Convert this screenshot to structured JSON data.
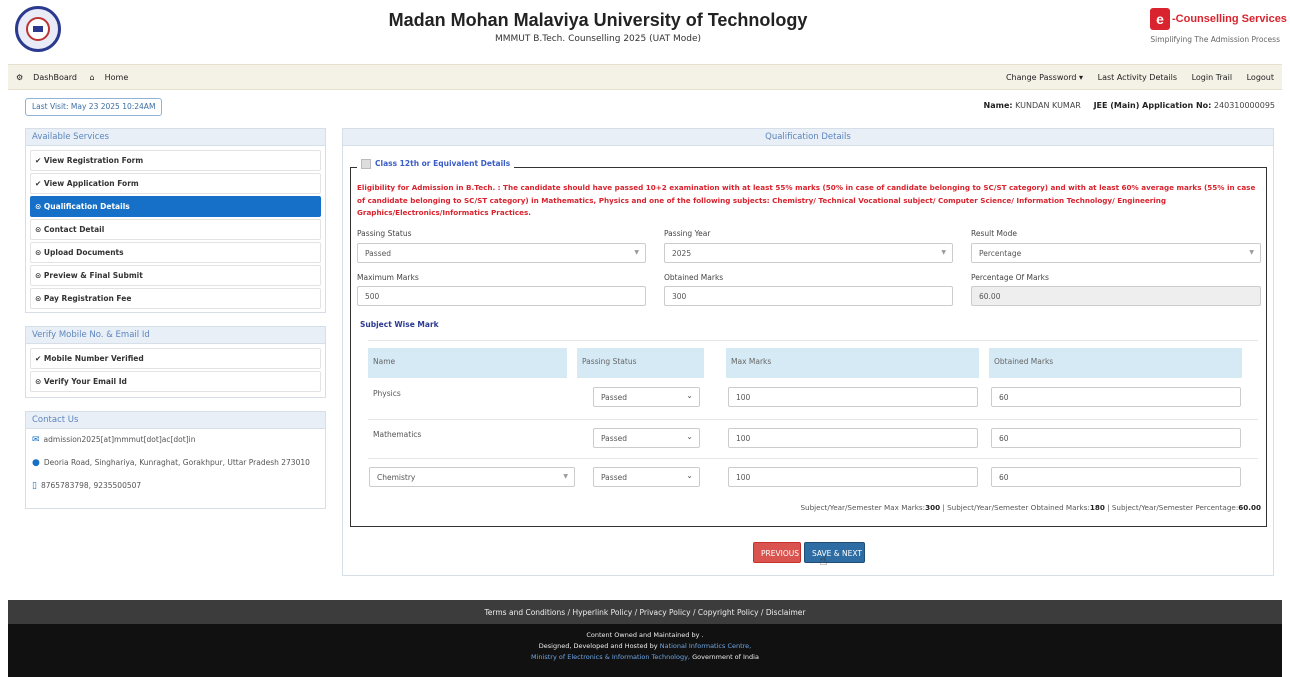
{
  "header": {
    "title": "Madan Mohan Malaviya University of Technology",
    "subtitle": "MMMUT B.Tech. Counselling 2025 (UAT Mode)",
    "brand_name": "-Counselling Services",
    "brand_tagline": "Simplifying The Admission Process",
    "brand_logo_letter": "e"
  },
  "nav": {
    "dashboard": "DashBoard",
    "home": "Home",
    "change_password": "Change Password ▾",
    "last_activity": "Last Activity Details",
    "login_trail": "Login Trail",
    "logout": "Logout"
  },
  "session": {
    "last_visit_label": "Last Visit:",
    "last_visit_value": "May 23 2025 10:24AM",
    "name_label": "Name:",
    "name_value": "KUNDAN KUMAR",
    "app_no_label": "JEE (Main) Application No:",
    "app_no_value": "240310000095"
  },
  "sidebar": {
    "services_title": "Available Services",
    "services": [
      {
        "label": "View Registration Form",
        "icon": "✔"
      },
      {
        "label": "View Application Form",
        "icon": "✔"
      },
      {
        "label": "Qualification Details",
        "icon": "⊙"
      },
      {
        "label": "Contact Detail",
        "icon": "⊙"
      },
      {
        "label": "Upload Documents",
        "icon": "⊙"
      },
      {
        "label": "Preview & Final Submit",
        "icon": "⊙"
      },
      {
        "label": "Pay Registration Fee",
        "icon": "⊙"
      }
    ],
    "verify_title": "Verify Mobile No. & Email Id",
    "verify": [
      {
        "label": "Mobile Number Verified",
        "icon": "✔"
      },
      {
        "label": "Verify Your Email Id",
        "icon": "⊙"
      }
    ],
    "contact_title": "Contact Us",
    "contact": {
      "email": "admission2025[at]mmmut[dot]ac[dot]in",
      "address": "Deoria Road, Singhariya, Kunraghat, Gorakhpur, Uttar Pradesh 273010",
      "phone": "8765783798, 9235500507"
    }
  },
  "main": {
    "title": "Qualification Details",
    "legend": "Class 12th or Equivalent Details",
    "eligibility": "Eligibility for Admission in B.Tech. : The candidate should have passed 10+2 examination with at least 55% marks (50% in case of candidate belonging to SC/ST category) and with at least 60% average marks (55% in case of candidate belonging to SC/ST category) in Mathematics, Physics and one of the following subjects: Chemistry/ Technical Vocational subject/ Computer Science/ Information Technology/ Engineering Graphics/Electronics/Informatics Practices.",
    "fields": {
      "passing_status_label": "Passing Status",
      "passing_status_value": "Passed",
      "passing_year_label": "Passing Year",
      "passing_year_value": "2025",
      "result_mode_label": "Result Mode",
      "result_mode_value": "Percentage",
      "max_marks_label": "Maximum Marks",
      "max_marks_value": "500",
      "obtained_marks_label": "Obtained Marks",
      "obtained_marks_value": "300",
      "percentage_label": "Percentage Of Marks",
      "percentage_value": "60.00"
    },
    "subject_heading": "Subject Wise Mark",
    "table_headers": [
      "Name",
      "Passing Status",
      "Max Marks",
      "Obtained Marks"
    ],
    "subjects": [
      {
        "name": "Physics",
        "status": "Passed",
        "max": "100",
        "obtained": "60"
      },
      {
        "name": "Mathematics",
        "status": "Passed",
        "max": "100",
        "obtained": "60"
      },
      {
        "name": "Chemistry",
        "status": "Passed",
        "max": "100",
        "obtained": "60"
      }
    ],
    "summary": {
      "max_label": "Subject/Year/Semester Max Marks:",
      "max_value": "300",
      "obt_label": "| Subject/Year/Semester Obtained Marks:",
      "obt_value": "180",
      "pct_label": "| Subject/Year/Semester Percentage:",
      "pct_value": "60.00"
    },
    "previous_button": "PREVIOUS",
    "next_button": "SAVE & NEXT"
  },
  "footer": {
    "links": "Terms and Conditions / Hyperlink Policy / Privacy Policy / Copyright Policy / Disclaimer",
    "line1": "Content Owned and Maintained by .",
    "line2_prefix": "Designed, Developed and Hosted by ",
    "line2_link": "National Informatics Centre,",
    "line3_link": "Ministry of Electronics & Information Technology,",
    "line3_suffix": " Government of India"
  }
}
